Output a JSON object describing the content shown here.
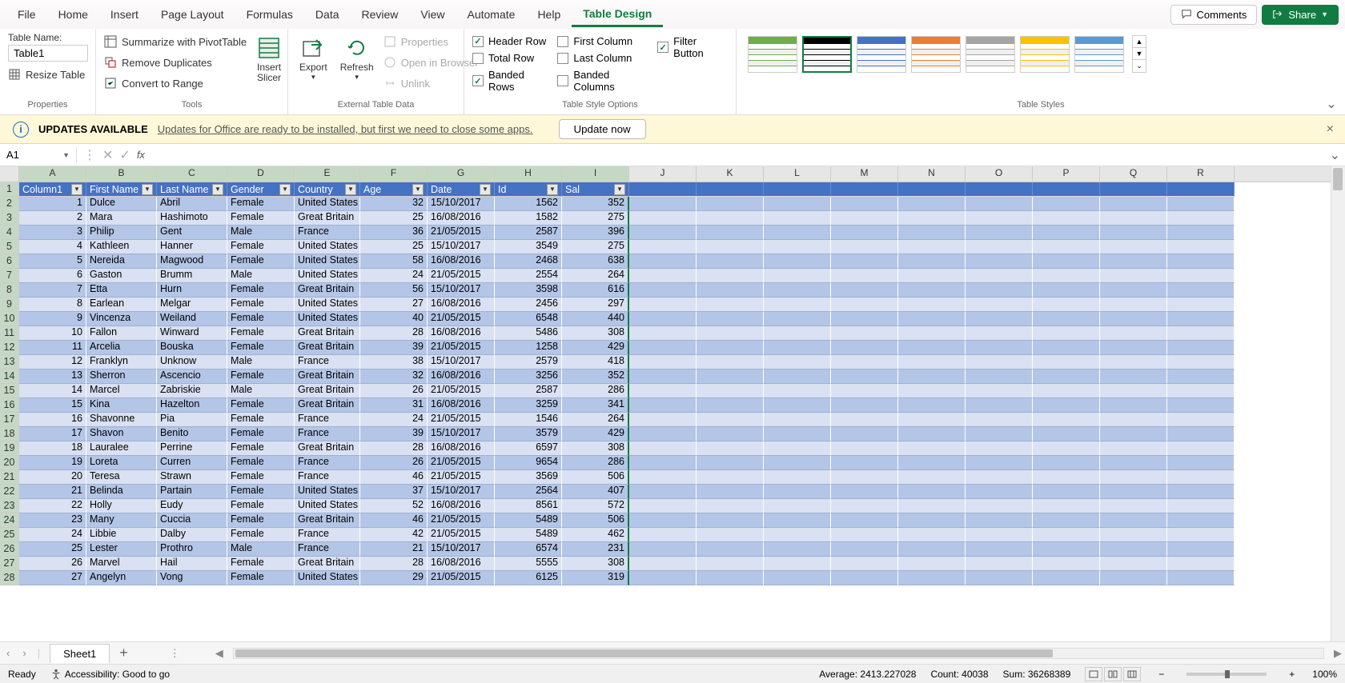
{
  "ribbon": {
    "tabs": [
      "File",
      "Home",
      "Insert",
      "Page Layout",
      "Formulas",
      "Data",
      "Review",
      "View",
      "Automate",
      "Help",
      "Table Design"
    ],
    "active_tab": "Table Design",
    "comments": "Comments",
    "share": "Share"
  },
  "properties": {
    "label": "Table Name:",
    "value": "Table1",
    "resize": "Resize Table",
    "group": "Properties"
  },
  "tools": {
    "pivot": "Summarize with PivotTable",
    "dup": "Remove Duplicates",
    "convert": "Convert to Range",
    "slicer": "Insert\nSlicer",
    "group": "Tools"
  },
  "external": {
    "export": "Export",
    "refresh": "Refresh",
    "props": "Properties",
    "browser": "Open in Browser",
    "unlink": "Unlink",
    "group": "External Table Data"
  },
  "style_opts": {
    "header_row": "Header Row",
    "total_row": "Total Row",
    "banded_rows": "Banded Rows",
    "first_col": "First Column",
    "last_col": "Last Column",
    "banded_cols": "Banded Columns",
    "filter": "Filter Button",
    "group": "Table Style Options"
  },
  "styles": {
    "group": "Table Styles"
  },
  "msg": {
    "title": "UPDATES AVAILABLE",
    "text": "Updates for Office are ready to be installed, but first we need to close some apps.",
    "button": "Update now"
  },
  "namebox": "A1",
  "cols": {
    "letters": [
      "A",
      "B",
      "C",
      "D",
      "E",
      "F",
      "G",
      "H",
      "I",
      "J",
      "K",
      "L",
      "M",
      "N",
      "O",
      "P",
      "Q",
      "R"
    ],
    "widths": [
      84,
      88,
      88,
      84,
      82,
      84,
      84,
      84,
      84,
      84,
      84,
      84,
      84,
      84,
      84,
      84,
      84,
      84
    ],
    "sel_through": 9
  },
  "headers": [
    "Column1",
    "First Name",
    "Last Name",
    "Gender",
    "Country",
    "Age",
    "Date",
    "Id",
    "Sal"
  ],
  "rows": [
    [
      1,
      "Dulce",
      "Abril",
      "Female",
      "United States",
      32,
      "15/10/2017",
      1562,
      352
    ],
    [
      2,
      "Mara",
      "Hashimoto",
      "Female",
      "Great Britain",
      25,
      "16/08/2016",
      1582,
      275
    ],
    [
      3,
      "Philip",
      "Gent",
      "Male",
      "France",
      36,
      "21/05/2015",
      2587,
      396
    ],
    [
      4,
      "Kathleen",
      "Hanner",
      "Female",
      "United States",
      25,
      "15/10/2017",
      3549,
      275
    ],
    [
      5,
      "Nereida",
      "Magwood",
      "Female",
      "United States",
      58,
      "16/08/2016",
      2468,
      638
    ],
    [
      6,
      "Gaston",
      "Brumm",
      "Male",
      "United States",
      24,
      "21/05/2015",
      2554,
      264
    ],
    [
      7,
      "Etta",
      "Hurn",
      "Female",
      "Great Britain",
      56,
      "15/10/2017",
      3598,
      616
    ],
    [
      8,
      "Earlean",
      "Melgar",
      "Female",
      "United States",
      27,
      "16/08/2016",
      2456,
      297
    ],
    [
      9,
      "Vincenza",
      "Weiland",
      "Female",
      "United States",
      40,
      "21/05/2015",
      6548,
      440
    ],
    [
      10,
      "Fallon",
      "Winward",
      "Female",
      "Great Britain",
      28,
      "16/08/2016",
      5486,
      308
    ],
    [
      11,
      "Arcelia",
      "Bouska",
      "Female",
      "Great Britain",
      39,
      "21/05/2015",
      1258,
      429
    ],
    [
      12,
      "Franklyn",
      "Unknow",
      "Male",
      "France",
      38,
      "15/10/2017",
      2579,
      418
    ],
    [
      13,
      "Sherron",
      "Ascencio",
      "Female",
      "Great Britain",
      32,
      "16/08/2016",
      3256,
      352
    ],
    [
      14,
      "Marcel",
      "Zabriskie",
      "Male",
      "Great Britain",
      26,
      "21/05/2015",
      2587,
      286
    ],
    [
      15,
      "Kina",
      "Hazelton",
      "Female",
      "Great Britain",
      31,
      "16/08/2016",
      3259,
      341
    ],
    [
      16,
      "Shavonne",
      "Pia",
      "Female",
      "France",
      24,
      "21/05/2015",
      1546,
      264
    ],
    [
      17,
      "Shavon",
      "Benito",
      "Female",
      "France",
      39,
      "15/10/2017",
      3579,
      429
    ],
    [
      18,
      "Lauralee",
      "Perrine",
      "Female",
      "Great Britain",
      28,
      "16/08/2016",
      6597,
      308
    ],
    [
      19,
      "Loreta",
      "Curren",
      "Female",
      "France",
      26,
      "21/05/2015",
      9654,
      286
    ],
    [
      20,
      "Teresa",
      "Strawn",
      "Female",
      "France",
      46,
      "21/05/2015",
      3569,
      506
    ],
    [
      21,
      "Belinda",
      "Partain",
      "Female",
      "United States",
      37,
      "15/10/2017",
      2564,
      407
    ],
    [
      22,
      "Holly",
      "Eudy",
      "Female",
      "United States",
      52,
      "16/08/2016",
      8561,
      572
    ],
    [
      23,
      "Many",
      "Cuccia",
      "Female",
      "Great Britain",
      46,
      "21/05/2015",
      5489,
      506
    ],
    [
      24,
      "Libbie",
      "Dalby",
      "Female",
      "France",
      42,
      "21/05/2015",
      5489,
      462
    ],
    [
      25,
      "Lester",
      "Prothro",
      "Male",
      "France",
      21,
      "15/10/2017",
      6574,
      231
    ],
    [
      26,
      "Marvel",
      "Hail",
      "Female",
      "Great Britain",
      28,
      "16/08/2016",
      5555,
      308
    ],
    [
      27,
      "Angelyn",
      "Vong",
      "Female",
      "United States",
      29,
      "21/05/2015",
      6125,
      319
    ]
  ],
  "sheet": {
    "name": "Sheet1"
  },
  "status": {
    "ready": "Ready",
    "access": "Accessibility: Good to go",
    "avg": "Average: 2413.227028",
    "count": "Count: 40038",
    "sum": "Sum: 36268389",
    "zoom": "100%"
  }
}
